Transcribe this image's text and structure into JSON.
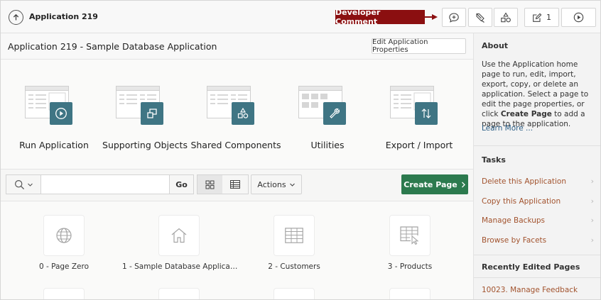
{
  "header": {
    "app_title": "Application 219",
    "developer_comment_label": "Developer Comment",
    "edit_count": "1"
  },
  "app": {
    "title": "Application 219 - Sample Database Application",
    "edit_properties_label": "Edit Application Properties"
  },
  "features": [
    {
      "label": "Run Application",
      "icon": "play-icon"
    },
    {
      "label": "Supporting Objects",
      "icon": "supporting-objects-icon"
    },
    {
      "label": "Shared Components",
      "icon": "shapes-icon"
    },
    {
      "label": "Utilities",
      "icon": "wrench-icon"
    },
    {
      "label": "Export / Import",
      "icon": "export-import-icon"
    }
  ],
  "toolbar": {
    "search_placeholder": "",
    "go_label": "Go",
    "actions_label": "Actions",
    "create_page_label": "Create Page"
  },
  "pages": [
    {
      "label": "0 - Page Zero",
      "icon": "globe-icon"
    },
    {
      "label": "1 - Sample Database Applica…",
      "icon": "home-icon"
    },
    {
      "label": "2 - Customers",
      "icon": "table-icon"
    },
    {
      "label": "3 - Products",
      "icon": "table-cursor-icon"
    }
  ],
  "sidebar": {
    "about_title": "About",
    "about_text_1": "Use the Application home page to run, edit, import, export, copy, or delete an application. Select a page to edit the page properties, or click ",
    "about_text_bold": "Create Page",
    "about_text_2": " to add a page to the application.",
    "learn_more": "Learn More ...",
    "tasks_title": "Tasks",
    "tasks": [
      "Delete this Application",
      "Copy this Application",
      "Manage Backups",
      "Browse by Facets"
    ],
    "recent_title": "Recently Edited Pages",
    "recent_pages": [
      "10023. Manage Feedback"
    ]
  },
  "colors": {
    "developer_comment": "#8b0f10",
    "create_page": "#2c7a4e",
    "feature_badge": "#3f7584",
    "task_link": "#a2532e"
  }
}
